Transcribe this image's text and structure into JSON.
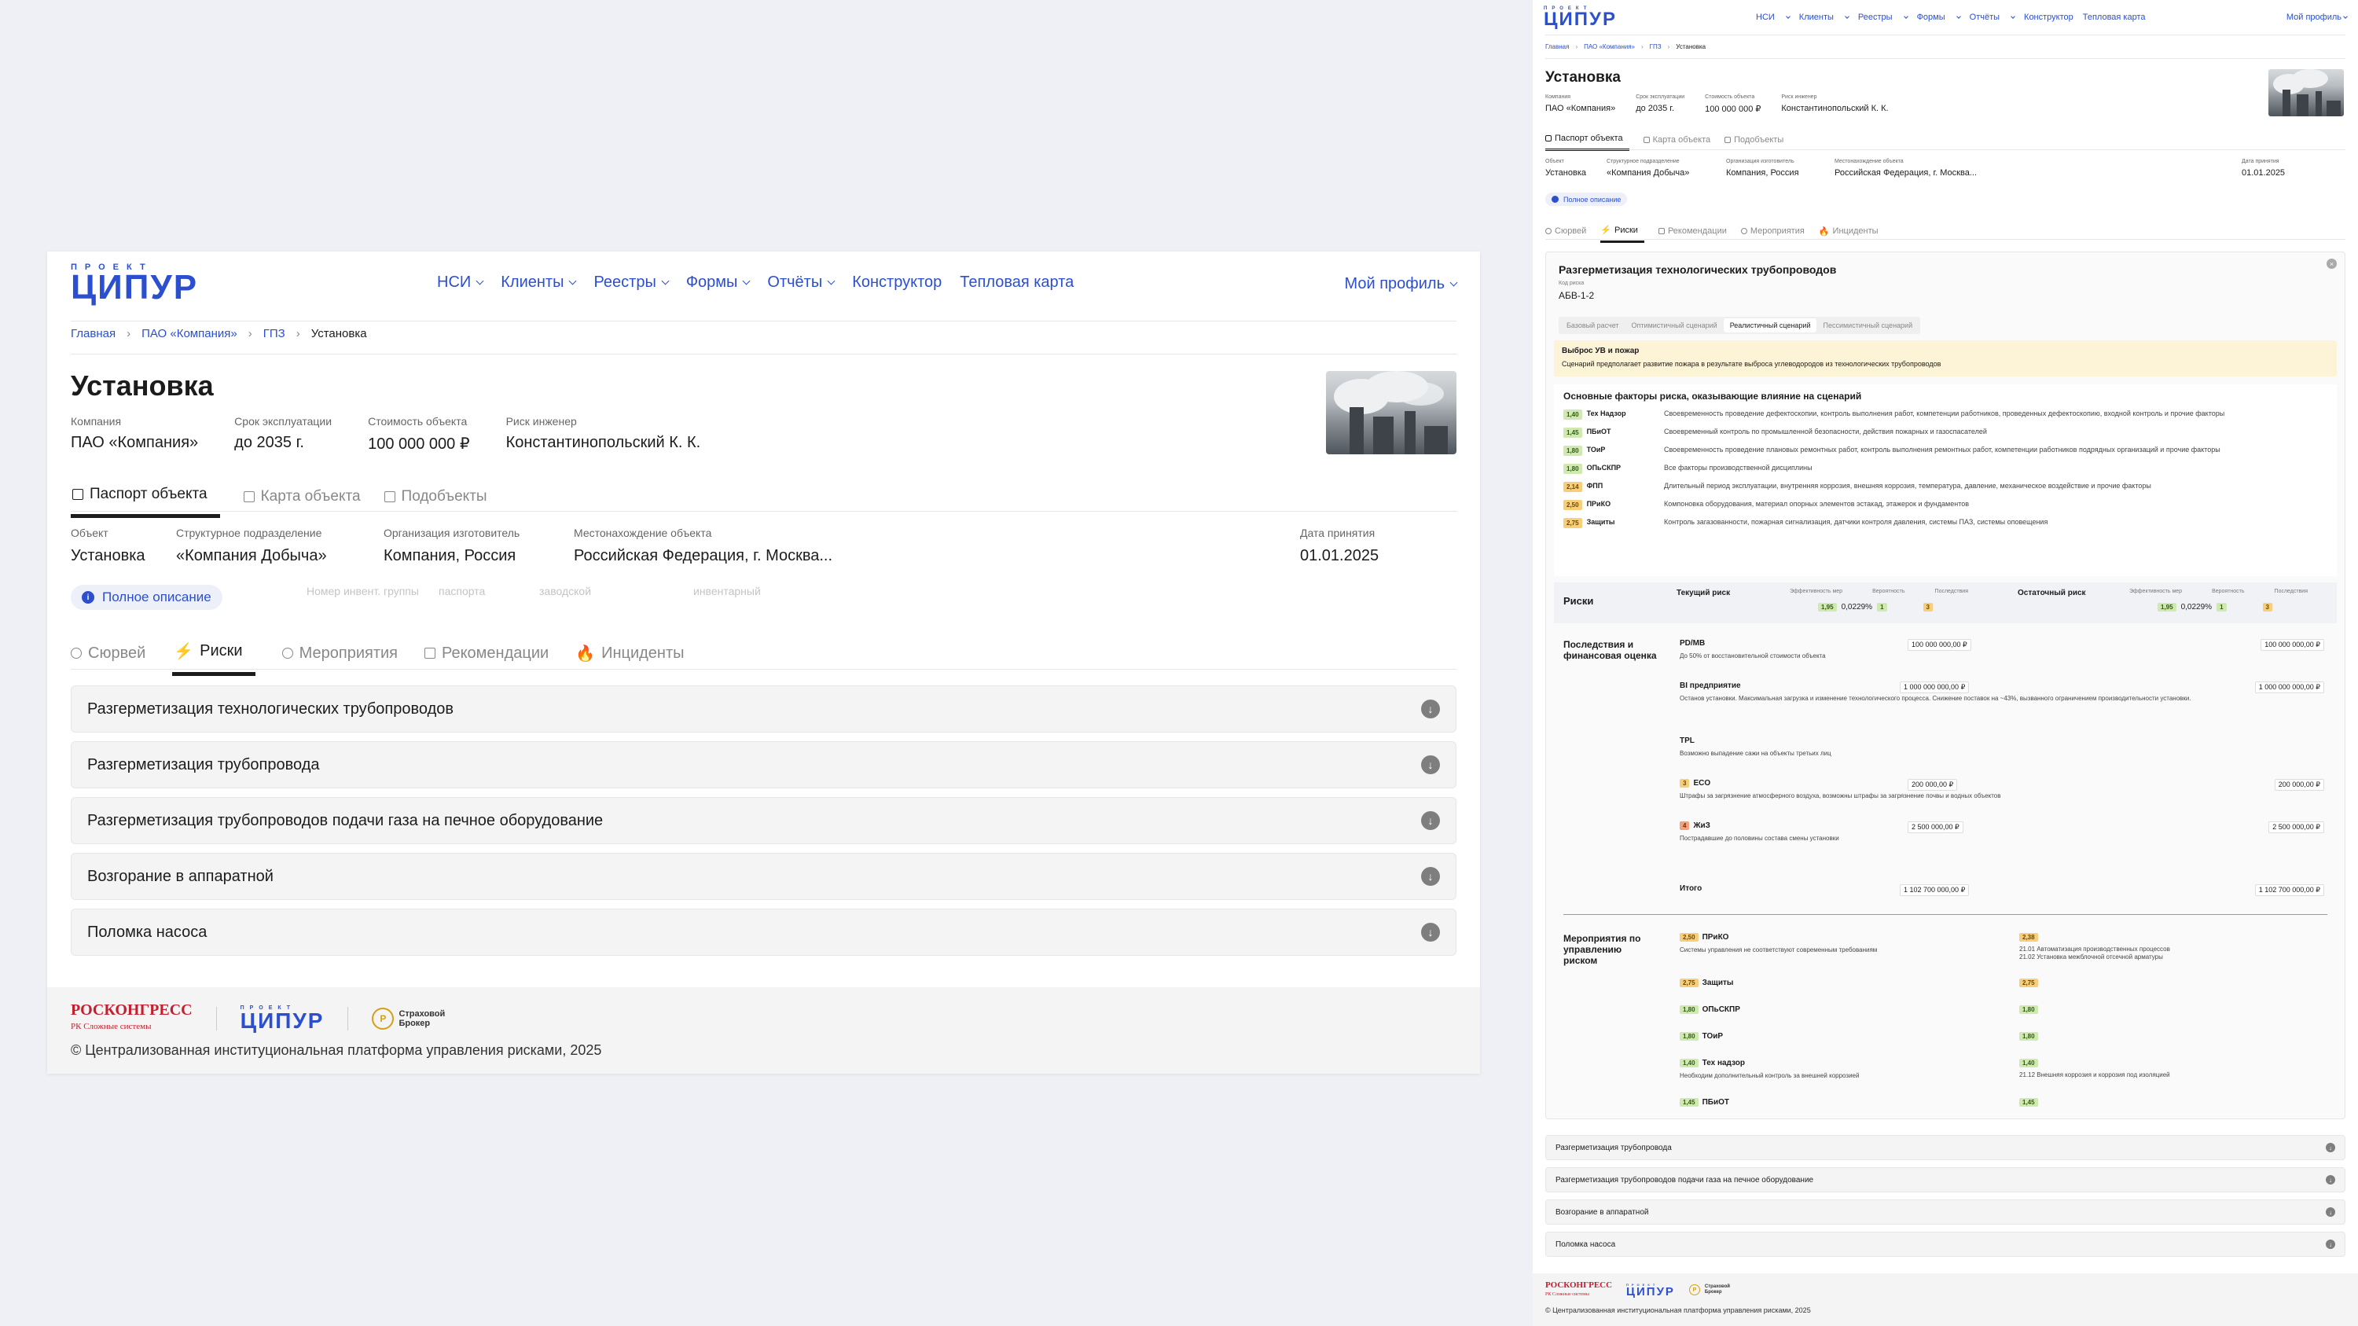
{
  "brand": {
    "small": "ПРОЕКТ",
    "big": "ЦИПУР",
    "color": "#2b4fcf"
  },
  "nav": [
    "НСИ",
    "Клиенты",
    "Реестры",
    "Формы",
    "Отчёты",
    "Конструктор",
    "Тепловая карта"
  ],
  "profile": "Мой профиль",
  "breadcrumbs": [
    "Главная",
    "ПАО «Компания»",
    "ГПЗ",
    "Установка"
  ],
  "page_title": "Установка",
  "meta": [
    {
      "k": "Компания",
      "v": "ПАО «Компания»"
    },
    {
      "k": "Срок эксплуатации",
      "v": "до 2035 г."
    },
    {
      "k": "Стоимость объекта",
      "v": "100 000 000 ₽"
    },
    {
      "k": "Риск инженер",
      "v": "Константинопольский К. К."
    }
  ],
  "tabs_top": [
    "Паспорт объекта",
    "Карта объекта",
    "Подобъекты"
  ],
  "object": [
    {
      "k": "Объект",
      "v": "Установка"
    },
    {
      "k": "Структурное подразделение",
      "v": "«Компания Добыча»"
    },
    {
      "k": "Организация изготовитель",
      "v": "Компания, Россия"
    },
    {
      "k": "Местонахождение объекта",
      "v": "Российская Федерация, г. Москва..."
    },
    {
      "k": "Дата принятия",
      "v": "01.01.2025"
    }
  ],
  "full_desc": "Полное описание",
  "ghost": [
    "Номер инвент. группы",
    "паспорта",
    "заводской",
    "инвентарный"
  ],
  "tabs_bottom": [
    "Сюрвей",
    "Риски",
    "Мероприятия",
    "Рекомендации",
    "Инциденты"
  ],
  "tabs_bottom_right": [
    "Сюрвей",
    "Риски",
    "Рекомендации",
    "Мероприятия",
    "Инциденты"
  ],
  "risks": [
    "Разгерметизация технологических трубопроводов",
    "Разгерметизация трубопровода",
    "Разгерметизация трубопроводов подачи газа на печное оборудование",
    "Возгорание в аппаратной",
    "Поломка насоса"
  ],
  "footer": {
    "rk": "РОСКОНГРЕСС",
    "rk_sub": "РК Сложные системы",
    "insure": [
      "Страховой",
      "Брокер"
    ],
    "copyright": "© Централизованная институциональная платформа управления рисками, 2025"
  },
  "detail": {
    "title": "Разгерметизация технологических трубопроводов",
    "code_label": "Код риска",
    "code": "АБВ-1-2",
    "scenarios": [
      "Базовый расчет",
      "Оптимистичный сценарий",
      "Реалистичный сценарий",
      "Пессимистичный сценарий"
    ],
    "alert_title": "Выброс УВ и пожар",
    "alert_text": "Сценарий предполагает развитие пожара в результате выброса углеводородов из технологических трубопроводов",
    "factors_title": "Основные факторы риска, оказывающие влияние на сценарий",
    "factors": [
      {
        "score": "1,40",
        "level": "green",
        "code": "Тех Надзор",
        "desc": "Своевременность проведение дефектоскопии, контроль выполнения работ, компетенции работников, проведенных дефектоскопию, входной контроль и прочие факторы"
      },
      {
        "score": "1,45",
        "level": "green",
        "code": "ПБиОТ",
        "desc": "Своевременный контроль по промышленной безопасности, действия пожарных и газоспасателей"
      },
      {
        "score": "1,80",
        "level": "green",
        "code": "ТОиР",
        "desc": "Своевременность проведение плановых ремонтных работ, контроль выполнения ремонтных работ, компетенции работников подрядных организаций и прочие факторы"
      },
      {
        "score": "1,80",
        "level": "green",
        "code": "ОПьСКПР",
        "desc": "Все факторы производственной дисциплины"
      },
      {
        "score": "2,14",
        "level": "orange",
        "code": "ФПП",
        "desc": "Длительный период эксплуатации, внутренняя коррозия, внешняя коррозия, температура, давление, механическое воздействие и прочие факторы"
      },
      {
        "score": "2,50",
        "level": "orange",
        "code": "ПРиКО",
        "desc": "Компоновка оборудования, материал опорных элементов эстакад, этажерок и фундаментов"
      },
      {
        "score": "2,75",
        "level": "orange",
        "code": "Защиты",
        "desc": "Контроль загазованности, пожарная сигнализация, датчики контроля давления, системы ПАЗ, системы оповещения"
      }
    ],
    "risks_label": "Риски",
    "current_label": "Текущий риск",
    "residual_label": "Остаточный риск",
    "col_labels": [
      "Эффективность мер",
      "Вероятность",
      "Последствия"
    ],
    "current_vals": [
      "1,95",
      "0,0229%",
      "1",
      "3"
    ],
    "residual_vals": [
      "1,95",
      "0,0229%",
      "1",
      "3"
    ],
    "conseq_label": "Последствия и финансовая оценка",
    "consequences": [
      {
        "name": "PD/MB",
        "badge": "",
        "desc": "До 50% от восстановительной стоимости объекта",
        "cur": "100 000 000,00 ₽",
        "res": "100 000 000,00 ₽"
      },
      {
        "name": "BI предприятие",
        "badge": "",
        "desc": "Останов установки. Максимальная загрузка и изменение технологического процесса. Снижение поставок на ~43%, вызванного ограничением производительности установки.",
        "cur": "1 000 000 000,00 ₽",
        "res": "1 000 000 000,00 ₽"
      },
      {
        "name": "TPL",
        "badge": "",
        "desc": "Возможно выпадение сажи на объекты третьих лиц",
        "cur": "",
        "res": ""
      },
      {
        "name": "ECO",
        "badge": "3",
        "desc": "Штрафы за загрязнение атмосферного воздуха, возможны штрафы за загрязнение почвы и водных объектов",
        "cur": "200 000,00 ₽",
        "res": "200 000,00 ₽"
      },
      {
        "name": "ЖиЗ",
        "badge": "4",
        "desc": "Пострадавшие до половины состава смены установки",
        "cur": "2 500 000,00 ₽",
        "res": "2 500 000,00 ₽"
      }
    ],
    "total_label": "Итого",
    "total_cur": "1 102 700 000,00 ₽",
    "total_res": "1 102 700 000,00 ₽",
    "measures_label": "Мероприятия по управлению риском",
    "measures": [
      {
        "score": "2,50",
        "level": "orange",
        "name": "ПРиКО",
        "desc": "Системы управления не соответствуют современным требованиям",
        "res": "2,38",
        "res_level": "orange",
        "res_desc": "21.01 Автоматизация производственных процессов\n21.02 Установка межблочной отсечной арматуры"
      },
      {
        "score": "2,75",
        "level": "orange",
        "name": "Защиты",
        "desc": "",
        "res": "2,75",
        "res_level": "orange",
        "res_desc": ""
      },
      {
        "score": "1,80",
        "level": "green",
        "name": "ОПьСКПР",
        "desc": "",
        "res": "1,80",
        "res_level": "green",
        "res_desc": ""
      },
      {
        "score": "1,80",
        "level": "green",
        "name": "ТОиР",
        "desc": "",
        "res": "1,80",
        "res_level": "green",
        "res_desc": ""
      },
      {
        "score": "1,40",
        "level": "green",
        "name": "Тех надзор",
        "desc": "Необходим дополнительный контроль за внешней коррозией",
        "res": "1,40",
        "res_level": "green",
        "res_desc": "21.12 Внешняя коррозия и коррозия под изоляцией"
      },
      {
        "score": "1,45",
        "level": "green",
        "name": "ПБиОТ",
        "desc": "",
        "res": "1,45",
        "res_level": "green",
        "res_desc": ""
      }
    ]
  }
}
